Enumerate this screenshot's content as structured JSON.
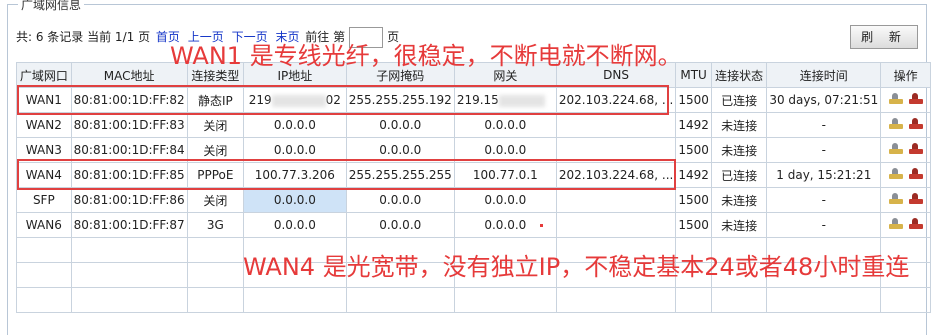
{
  "panel": {
    "title": "广域网信息"
  },
  "pager": {
    "summary": "共: 6 条记录 当前 1/1 页",
    "first": "首页",
    "prev": "上一页",
    "next": "下一页",
    "last": "末页",
    "goto_prefix": "前往 第",
    "goto_suffix": "页",
    "goto_value": ""
  },
  "toolbar": {
    "refresh_label": "刷 新"
  },
  "table": {
    "headers": [
      "广域网口",
      "MAC地址",
      "连接类型",
      "IP地址",
      "子网掩码",
      "网关",
      "DNS",
      "MTU",
      "连接状态",
      "连接时间",
      "操作"
    ],
    "rows": [
      {
        "port": "WAN1",
        "mac": "80:81:00:1D:FF:82",
        "type": "静态IP",
        "ip_a": "219",
        "ip_b": "02",
        "mask": "255.255.255.192",
        "gw": "219.15",
        "dns": "202.103.224.68, ...",
        "mtu": "1500",
        "status": "已连接",
        "time": "30 days, 07:21:51"
      },
      {
        "port": "WAN2",
        "mac": "80:81:00:1D:FF:83",
        "type": "关闭",
        "ip": "0.0.0.0",
        "mask": "0.0.0.0",
        "gw": "0.0.0.0",
        "dns": "",
        "mtu": "1492",
        "status": "未连接",
        "time": "-"
      },
      {
        "port": "WAN3",
        "mac": "80:81:00:1D:FF:84",
        "type": "关闭",
        "ip": "0.0.0.0",
        "mask": "0.0.0.0",
        "gw": "0.0.0.0",
        "dns": "",
        "mtu": "1500",
        "status": "未连接",
        "time": "-"
      },
      {
        "port": "WAN4",
        "mac": "80:81:00:1D:FF:85",
        "type": "PPPoE",
        "ip": "100.77.3.206",
        "mask": "255.255.255.255",
        "gw": "100.77.0.1",
        "dns": "202.103.224.68, ...",
        "mtu": "1492",
        "status": "已连接",
        "time": "1 day, 15:21:21"
      },
      {
        "port": "SFP",
        "mac": "80:81:00:1D:FF:86",
        "type": "关闭",
        "ip": "0.0.0.0",
        "mask": "0.0.0.0",
        "gw": "0.0.0.0",
        "dns": "",
        "mtu": "1500",
        "status": "未连接",
        "time": "-"
      },
      {
        "port": "WAN6",
        "mac": "80:81:00:1D:FF:87",
        "type": "3G",
        "ip": "0.0.0.0",
        "mask": "0.0.0.0",
        "gw": "0.0.0.0",
        "dns": "",
        "mtu": "1500",
        "status": "未连接",
        "time": "-"
      }
    ]
  },
  "annotations": {
    "wan1_note": "WAN1 是专线光纤，很稳定，不断电就不断网。",
    "wan4_note": "WAN4 是光宽带，没有独立IP，不稳定基本24或者48小时重连"
  },
  "colors": {
    "annotation": "#e63a3a",
    "link": "#1536c8",
    "selected_cell": "#cfe3f7"
  }
}
